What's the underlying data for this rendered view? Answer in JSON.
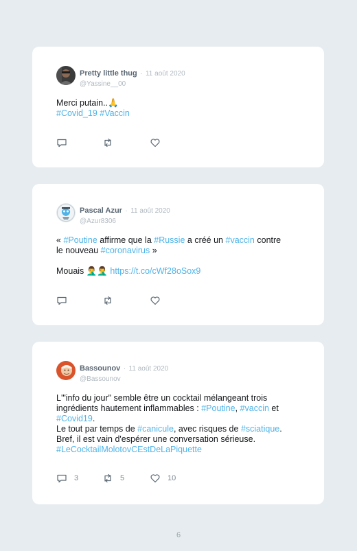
{
  "tweets": [
    {
      "name": "Pretty little thug",
      "separator": "·",
      "date": "11 août 2020",
      "handle": "@Yassine__00",
      "lines": [
        [
          {
            "t": "Merci putain..🙏",
            "tag": false
          }
        ],
        [
          {
            "t": "#Covid_19",
            "tag": true
          },
          {
            "t": " ",
            "tag": false
          },
          {
            "t": "#Vaccin",
            "tag": true
          }
        ]
      ],
      "counts": {
        "reply": "",
        "retweet": "",
        "like": ""
      }
    },
    {
      "name": "Pascal Azur",
      "separator": "·",
      "date": "11 août 2020",
      "handle": "@Azur8306",
      "lines": [
        [
          {
            "t": "« ",
            "tag": false
          },
          {
            "t": "#Poutine",
            "tag": true
          },
          {
            "t": " affirme que la ",
            "tag": false
          },
          {
            "t": "#Russie",
            "tag": true
          },
          {
            "t": " a créé un ",
            "tag": false
          },
          {
            "t": "#vaccin",
            "tag": true
          },
          {
            "t": " contre",
            "tag": false
          }
        ],
        [
          {
            "t": "le nouveau ",
            "tag": false
          },
          {
            "t": "#coronavirus",
            "tag": true
          },
          {
            "t": " »",
            "tag": false
          }
        ],
        [],
        [
          {
            "t": "Mouais 🤦‍♂️🤦‍♂️ ",
            "tag": false
          },
          {
            "t": "https://t.co/cWf28oSox9",
            "tag": true
          }
        ]
      ],
      "counts": {
        "reply": "",
        "retweet": "",
        "like": ""
      }
    },
    {
      "name": "Bassounov",
      "separator": "·",
      "date": "11 août 2020",
      "handle": "@Bassounov",
      "lines": [
        [
          {
            "t": "L'\"info du jour\" semble être un cocktail mélangeant trois",
            "tag": false
          }
        ],
        [
          {
            "t": "ingrédients hautement inflammables : ",
            "tag": false
          },
          {
            "t": "#Poutine",
            "tag": true
          },
          {
            "t": ", ",
            "tag": false
          },
          {
            "t": "#vaccin",
            "tag": true
          },
          {
            "t": " et",
            "tag": false
          }
        ],
        [
          {
            "t": "#Covid19",
            "tag": true
          },
          {
            "t": ".",
            "tag": false
          }
        ],
        [
          {
            "t": "Le tout par temps de ",
            "tag": false
          },
          {
            "t": "#canicule",
            "tag": true
          },
          {
            "t": ", avec risques de ",
            "tag": false
          },
          {
            "t": "#sciatique",
            "tag": true
          },
          {
            "t": ".",
            "tag": false
          }
        ],
        [
          {
            "t": "Bref, il est vain d'espérer une conversation sérieuse.",
            "tag": false
          }
        ],
        [
          {
            "t": "#LeCocktailMolotovCEstDeLaPiquette",
            "tag": true
          }
        ]
      ],
      "counts": {
        "reply": "3",
        "retweet": "5",
        "like": "10"
      }
    }
  ],
  "page_number": "6",
  "colors": {
    "background": "#e6ecef",
    "card": "#ffffff",
    "hashtag": "#4fb3e8",
    "meta": "#b0b9c0",
    "name": "#5a6772"
  },
  "icons": [
    "reply-icon",
    "retweet-icon",
    "like-icon"
  ]
}
